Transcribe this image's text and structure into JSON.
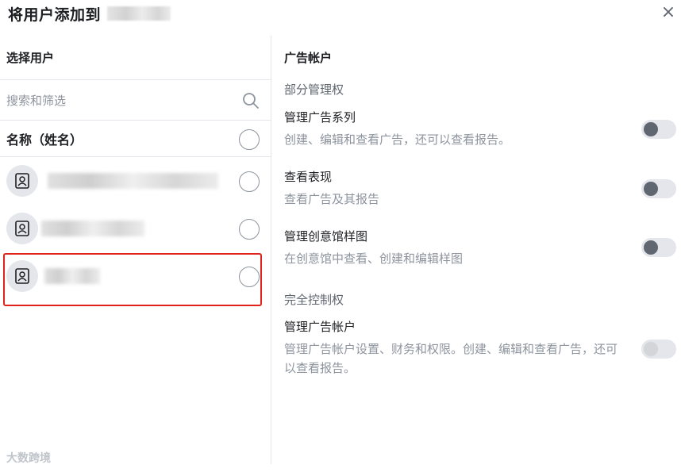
{
  "dialog": {
    "title": "将用户添加到",
    "close_icon": "×"
  },
  "left": {
    "heading": "选择用户",
    "search_placeholder": "搜索和筛选",
    "column_header": "名称（姓名）",
    "users": [
      {
        "name_hidden": true,
        "icon": "user-avatar-icon"
      },
      {
        "name_hidden": true,
        "icon": "user-avatar-icon"
      },
      {
        "name_hidden": true,
        "icon": "user-avatar-icon",
        "highlighted": true
      }
    ]
  },
  "right": {
    "heading": "广告帐户",
    "partial_section": "部分管理权",
    "full_section": "完全控制权",
    "permissions": [
      {
        "title": "管理广告系列",
        "desc": "创建、编辑和查看广告，还可以查看报告。",
        "enabled": true,
        "on": false
      },
      {
        "title": "查看表现",
        "desc": "查看广告及其报告",
        "enabled": true,
        "on": false
      },
      {
        "title": "管理创意馆样图",
        "desc": "在创意馆中查看、创建和编辑样图",
        "enabled": true,
        "on": false
      },
      {
        "title": "管理广告帐户",
        "desc": "管理广告帐户设置、财务和权限。创建、编辑和查看广告，还可以查看报告。",
        "enabled": false,
        "on": false
      }
    ]
  },
  "watermark": "大数跨境",
  "colors": {
    "highlight_border": "#e0231a",
    "toggle_knob": "#606770",
    "toggle_track": "#e4e6eb",
    "muted_text": "#8d949e"
  }
}
